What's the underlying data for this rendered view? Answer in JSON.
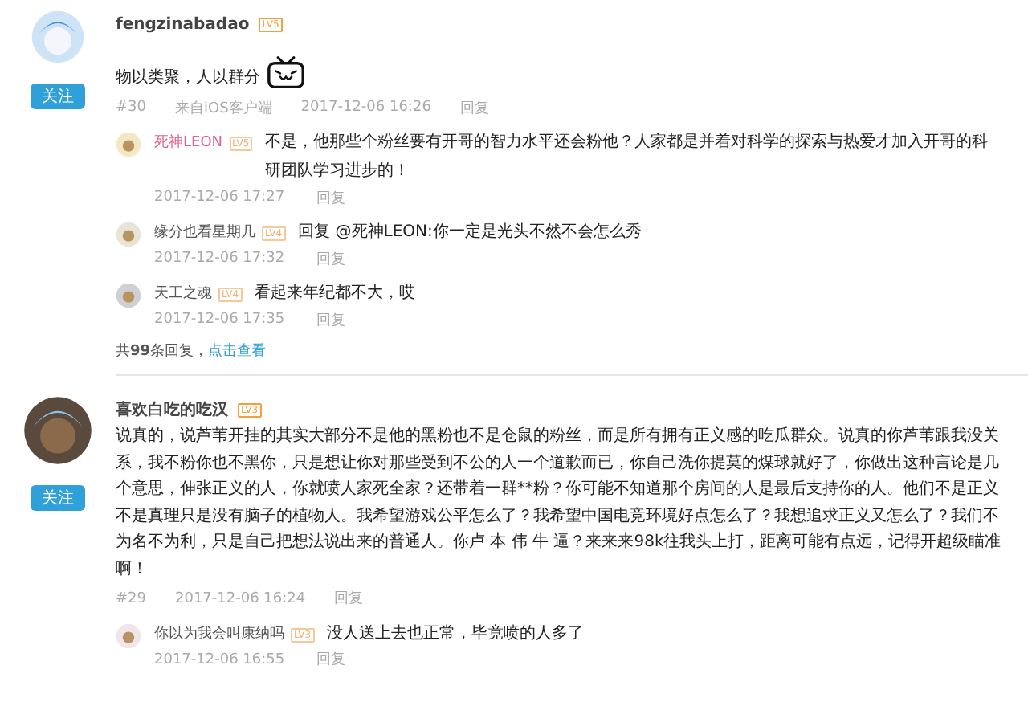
{
  "comments": [
    {
      "user": "fengzinabadao",
      "level": "LV5",
      "follow_label": "关注",
      "text": "物以类聚，人以群分",
      "has_emoji": true,
      "floor": "#30",
      "source": "来自iOS客户端",
      "time": "2017-12-06 16:26",
      "reply_label": "回复",
      "replies": [
        {
          "user": "死神LEON",
          "user_highlight": true,
          "level": "LV5",
          "text": "不是，他那些个粉丝要有开哥的智力水平还会粉他？人家都是并着对科学的探索与热爱才加入开哥的科研团队学习进步的！",
          "time": "2017-12-06 17:27",
          "reply_label": "回复"
        },
        {
          "user": "缘分也看星期几",
          "user_highlight": false,
          "level": "LV4",
          "text": "回复 @死神LEON:你一定是光头不然不会怎么秀",
          "time": "2017-12-06 17:32",
          "reply_label": "回复"
        },
        {
          "user": "天工之魂",
          "user_highlight": false,
          "level": "LV4",
          "text": "看起来年纪都不大，哎",
          "time": "2017-12-06 17:35",
          "reply_label": "回复"
        }
      ],
      "more": {
        "summary": "共**99**条回复，",
        "link": "点击查看"
      }
    },
    {
      "user": "喜欢白吃的吃汉",
      "level": "LV3",
      "follow_label": "关注",
      "text": "说真的，说芦苇开挂的其实大部分不是他的黑粉也不是仓鼠的粉丝，而是所有拥有正义感的吃瓜群众。说真的你芦苇跟我没关系，我不粉你也不黑你，只是想让你对那些受到不公的人一个道歉而已，你自己洗你提莫的煤球就好了，你做出这种言论是几个意思，伸张正义的人，你就喷人家死全家？还带着一群**粉？你可能不知道那个房间的人是最后支持你的人。他们不是正义不是真理只是没有脑子的植物人。我希望游戏公平怎么了？我希望中国电竞环境好点怎么了？我想追求正义又怎么了？我们不为名不为利，只是自己把想法说出来的普通人。你卢 本 伟 牛 逼？来来来98k往我头上打，距离可能有点远，记得开超级瞄准啊！",
      "has_emoji": false,
      "floor": "#29",
      "time": "2017-12-06 16:24",
      "reply_label": "回复",
      "replies": [
        {
          "user": "你以为我会叫康纳吗",
          "user_highlight": false,
          "level": "LV3",
          "text": "没人送上去也正常，毕竟喷的人多了",
          "time": "2017-12-06 16:55",
          "reply_label": "回复"
        }
      ]
    }
  ]
}
